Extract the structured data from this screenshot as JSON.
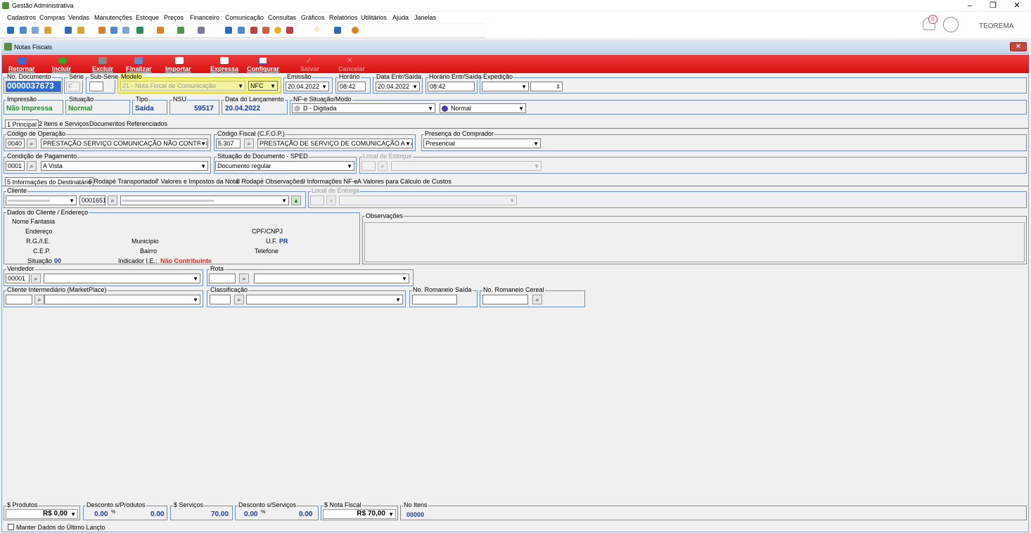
{
  "app": {
    "title": "Gestão Administrativa",
    "user": "TEOREMA",
    "notif_count": "0"
  },
  "menu": [
    "Cadastros",
    "Compras",
    "Vendas",
    "Manutenções",
    "Estoque",
    "Preços",
    "Financeiro",
    "Comunicação",
    "Consultas",
    "Gráficos",
    "Relatórios",
    "Utilitários",
    "Ajuda",
    "Janelas"
  ],
  "window": {
    "title": "Notas Fiscais"
  },
  "toolbar": {
    "retornar": "Retornar",
    "incluir": "Incluir",
    "excluir": "Excluir",
    "finalizar": "Finalizar",
    "importar": "Importar",
    "expressa": "Expressa",
    "configurar": "Configurar",
    "salvar": "Salvar",
    "cancelar": "Cancelar"
  },
  "header": {
    "no_documento_label": "No. Documento",
    "no_documento": "0000037673",
    "serie_label": "Série",
    "serie": "F",
    "subserie_label": "Sub-Série",
    "subserie": "",
    "modelo_label": "Modelo",
    "modelo": "21 - Nota Fiscal de Comunicação",
    "modelo_tipo": "NFC",
    "emissao_label": "Emissão",
    "emissao": "20.04.2022",
    "horario_label": "Horário",
    "horario": "08:42",
    "data_entr_label": "Data Entr/Saída",
    "data_entr": "20.04.2022",
    "horario_entr_label": "Horário Entr/Saída",
    "horario_entr": "08:42",
    "expedicao_label": "Expedição",
    "expedicao": ""
  },
  "status": {
    "impressao_label": "Impressão",
    "impressao": "Não Impressa",
    "situacao_label": "Situação",
    "situacao": "Normal",
    "tipo_label": "Tipo",
    "tipo": "Saída",
    "nsu_label": "NSU",
    "nsu": "59517",
    "data_lanc_label": "Data do Lançamento",
    "data_lanc": "20.04.2022",
    "nfe_label": "NF-e Situação/Modo",
    "nfe_situacao": "D - Digitada",
    "nfe_modo": "Normal"
  },
  "tabs": [
    "1 Principal",
    "2 Itens e Serviços",
    "Documentos Referenciados"
  ],
  "principal": {
    "cod_operacao_label": "Código de Operação",
    "cod_operacao": "0040",
    "cod_operacao_desc": "PRESTAÇÃO SERVIÇO COMUNICAÇÃO NÃO CONTRIBUII",
    "cfop_label": "Código Fiscal (C.F.O.P.)",
    "cfop": "5.307",
    "cfop_desc": "PRESTAÇÃO DE SERVIÇO DE COMUNICAÇÃO A NÃO",
    "presenca_label": "Presença do Comprador",
    "presenca": "Presencial",
    "cond_pag_label": "Condição de Pagamento",
    "cond_pag": "0001",
    "cond_pag_desc": "A Vista",
    "sit_doc_label": "Situação do Documento - SPED",
    "sit_doc": "Documento regular",
    "local_estoque_label": "Local de Estoque"
  },
  "subtabs": [
    "5 Informações do Destinatário",
    "6 Rodapé Transportador",
    "7 Valores e Impostos da Nota",
    "8 Rodapé Observações",
    "9 Informações NF-e",
    "A Valores para Cálculo de Custos"
  ],
  "destinatario": {
    "cliente_label": "Cliente",
    "cliente_cod": "0001651",
    "local_entrega_label": "Local de Entrega",
    "dados_label": "Dados do Cliente / Endereço",
    "nome_fantasia": "Nome Fantasia",
    "endereco": "Endereço",
    "cpf_cnpj": "CPF/CNPJ",
    "rg_ie": "R.G./I.E.",
    "municipio": "Município",
    "uf_label": "U.F.",
    "uf": "PR",
    "cep": "C.E.P.",
    "bairro": "Bairro",
    "telefone": "Telefone",
    "situacao_label": "Situação",
    "situacao": "00",
    "indicador_label": "Indicador I.E.:",
    "indicador": "Não Contribuinte",
    "observacoes_label": "Observações",
    "vendedor_label": "Vendedor",
    "vendedor": "00001",
    "rota_label": "Rota",
    "intermediario_label": "Cliente Intermediário (MarketPlace)",
    "classificacao_label": "Classificação",
    "romaneio_saida_label": "No. Romaneio Saída",
    "romaneio_cereal_label": "No. Romaneio Cereal"
  },
  "footer": {
    "produtos_label": "$ Produtos",
    "produtos": "R$ 0,00",
    "desc_prod_label": "Desconto s/Produtos",
    "desc_prod_pct": "0.00",
    "desc_prod": "0.00",
    "servicos_label": "$ Serviços",
    "servicos": "70.00",
    "desc_serv_label": "Desconto s/Serviços",
    "desc_serv_pct": "0.00",
    "desc_serv": "0.00",
    "nota_label": "$ Nota Fiscal",
    "nota": "R$ 70,00",
    "itens_label": "No Itens",
    "itens": "00000",
    "manter": "Manter Dados do Último Lançto"
  }
}
